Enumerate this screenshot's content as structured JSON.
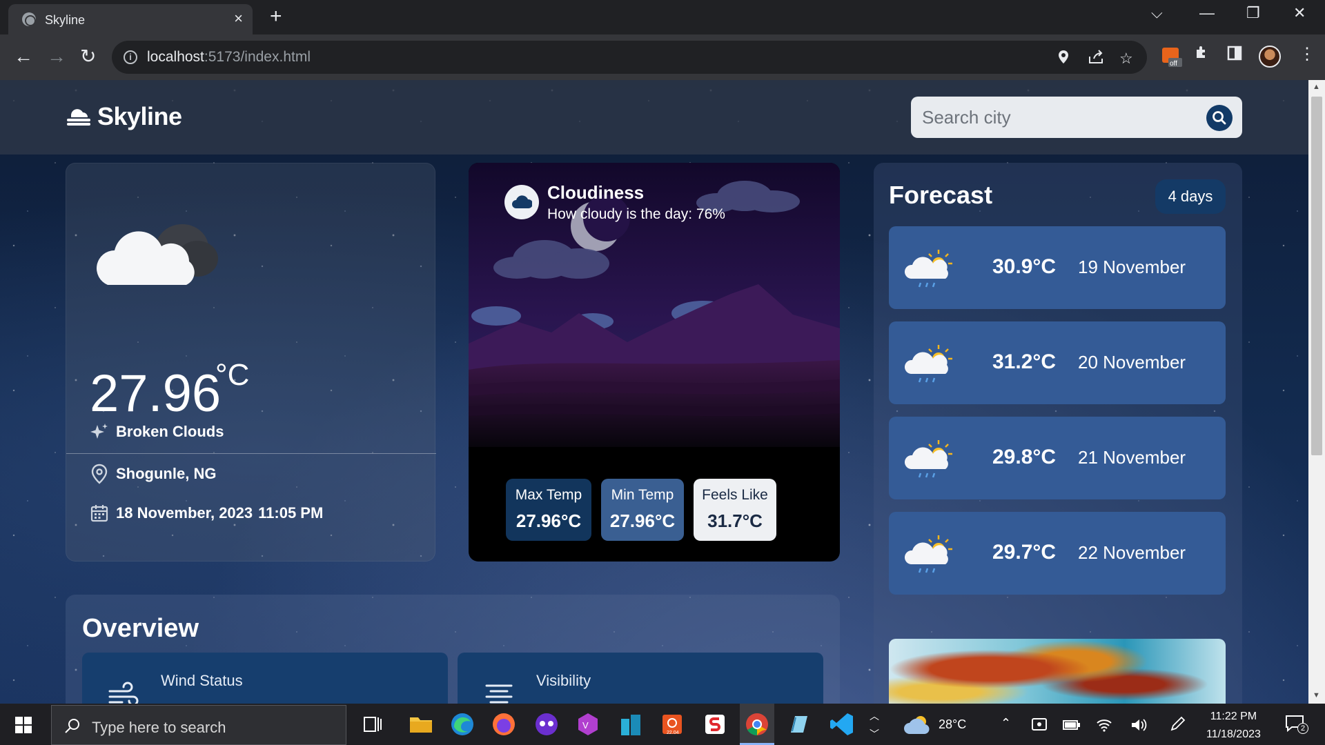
{
  "browser": {
    "tab_title": "Skyline",
    "url_host": "localhost",
    "url_rest": ":5173/index.html"
  },
  "app": {
    "name": "Skyline",
    "search_placeholder": "Search city"
  },
  "current": {
    "temperature": "27.96",
    "unit": "°C",
    "condition": "Broken Clouds",
    "location": "Shogunle, NG",
    "date": "18 November, 2023",
    "time": "11:05 PM"
  },
  "cloudiness": {
    "title": "Cloudiness",
    "subtitle": "How cloudy is the day: 76%",
    "max_label": "Max Temp",
    "max_value": "27.96°C",
    "min_label": "Min Temp",
    "min_value": "27.96°C",
    "feels_label": "Feels Like",
    "feels_value": "31.7°C"
  },
  "forecast": {
    "title": "Forecast",
    "badge": "4 days",
    "items": [
      {
        "temp": "30.9°C",
        "date": "19 November",
        "icon": "partly-cloudy-rain-icon"
      },
      {
        "temp": "31.2°C",
        "date": "20 November",
        "icon": "partly-cloudy-rain-icon"
      },
      {
        "temp": "29.8°C",
        "date": "21 November",
        "icon": "partly-cloudy-rain-icon"
      },
      {
        "temp": "29.7°C",
        "date": "22 November",
        "icon": "partly-cloudy-rain-icon"
      }
    ]
  },
  "overview": {
    "title": "Overview",
    "wind_label": "Wind Status",
    "visibility_label": "Visibility"
  },
  "taskbar": {
    "search_placeholder": "Type here to search",
    "weather_temp": "28°C",
    "time": "11:22 PM",
    "date": "11/18/2023",
    "notification_count": "2"
  },
  "colors": {
    "forecast_card": "#345b96",
    "badge": "#143a66",
    "max_pill": "#12355c",
    "min_pill": "#3a5f92",
    "feels_pill": "#eef0f3"
  }
}
